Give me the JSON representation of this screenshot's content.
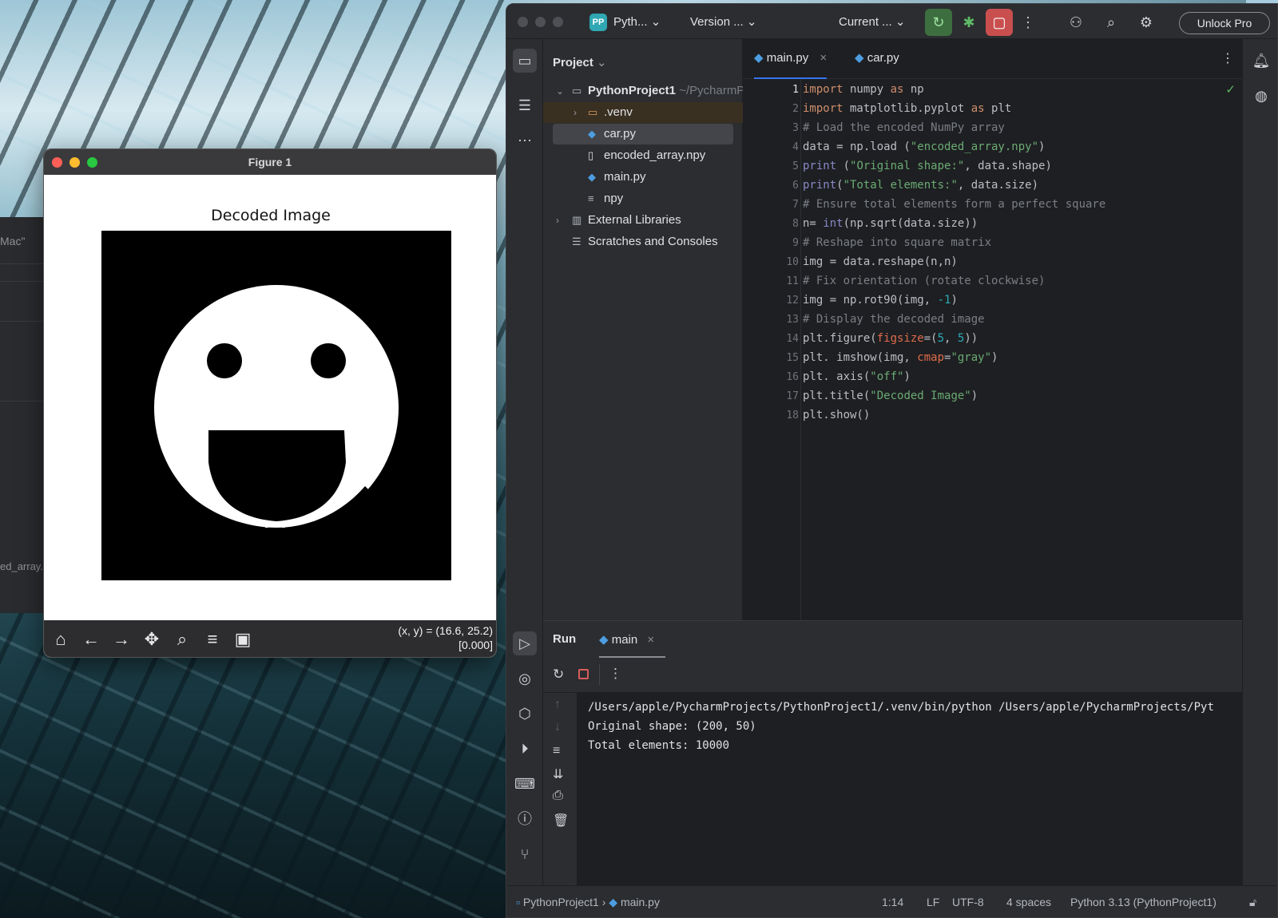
{
  "figure_window": {
    "title": "Figure 1",
    "plot_title": "Decoded Image",
    "coords_line1": "(x, y) = (16.6, 25.2)",
    "coords_line2": "[0.000]",
    "toolbar": [
      "home",
      "back",
      "forward",
      "pan",
      "zoom",
      "configure",
      "save"
    ]
  },
  "ghost_window": {
    "top_text": "Mac\"",
    "bottom_text": "ed_array."
  },
  "ide": {
    "project_badge": "PP",
    "project_name": "Pyth...",
    "vcs": "Version ...",
    "run_config": "Current ...",
    "unlock": "Unlock Pro",
    "panel_title": "Project",
    "tree": {
      "root": "PythonProject1",
      "root_path": "~/PycharmP",
      "venv": ".venv",
      "car": "car.py",
      "encoded": "encoded_array.npy",
      "main": "main.py",
      "npy": "npy",
      "ext": "External Libraries",
      "scratch": "Scratches and Consoles"
    },
    "tabs": [
      "main.py",
      "car.py"
    ],
    "line_numbers": [
      "1",
      "2",
      "3",
      "4",
      "5",
      "6",
      "7",
      "8",
      "9",
      "10",
      "11",
      "12",
      "13",
      "14",
      "15",
      "16",
      "17",
      "18"
    ],
    "run": {
      "label": "Run",
      "tab": "main",
      "out1": "/Users/apple/PycharmProjects/PythonProject1/.venv/bin/python /Users/apple/PycharmProjects/Pyt",
      "out2": "Original shape: (200, 50)",
      "out3": "Total elements: 10000"
    },
    "status": {
      "crumb_project": "PythonProject1",
      "crumb_file": "main.py",
      "position": "1:14",
      "line_sep": "LF",
      "encoding": "UTF-8",
      "indent": "4 spaces",
      "interpreter": "Python 3.13 (PythonProject1)"
    }
  },
  "code": {
    "l1_a": "import",
    "l1_b": " numpy ",
    "l1_c": "as",
    "l1_d": " np",
    "l2_a": "import",
    "l2_b": " matplotlib.pyplot ",
    "l2_c": "as",
    "l2_d": " plt",
    "l3": "# Load the encoded NumPy array",
    "l4_a": "data = np.load (",
    "l4_b": "\"encoded_array.npy\"",
    "l4_c": ")",
    "l5_a": "print",
    "l5_b": " (",
    "l5_c": "\"Original shape:\"",
    "l5_d": ", data.shape)",
    "l6_a": "print",
    "l6_b": "(",
    "l6_c": "\"Total elements:\"",
    "l6_d": ", data.size)",
    "l7": "# Ensure total elements form a perfect square",
    "l8_a": "n= ",
    "l8_b": "int",
    "l8_c": "(np.sqrt(data.size))",
    "l9": "# Reshape into square matrix",
    "l10": "img = data.reshape(n,n)",
    "l11": "# Fix orientation (rotate clockwise)",
    "l12_a": "img = np.rot90(img, ",
    "l12_b": "-1",
    "l12_c": ")",
    "l13": "# Display the decoded image",
    "l14_a": "plt.figure(",
    "l14_b": "figsize",
    "l14_c": "=(",
    "l14_d": "5",
    "l14_e": ", ",
    "l14_f": "5",
    "l14_g": "))",
    "l15_a": "plt. imshow(img, ",
    "l15_b": "cmap",
    "l15_c": "=",
    "l15_d": "\"gray\"",
    "l15_e": ")",
    "l16_a": "plt. axis(",
    "l16_b": "\"off\"",
    "l16_c": ")",
    "l17_a": "plt.title(",
    "l17_b": "\"Decoded Image\"",
    "l17_c": ")",
    "l18": "plt.show()"
  },
  "colors": {
    "accent_blue": "#3574f0",
    "run_green": "#5fb865",
    "stop_red": "#db5c5c",
    "badge_teal": "#2fa8b3"
  }
}
